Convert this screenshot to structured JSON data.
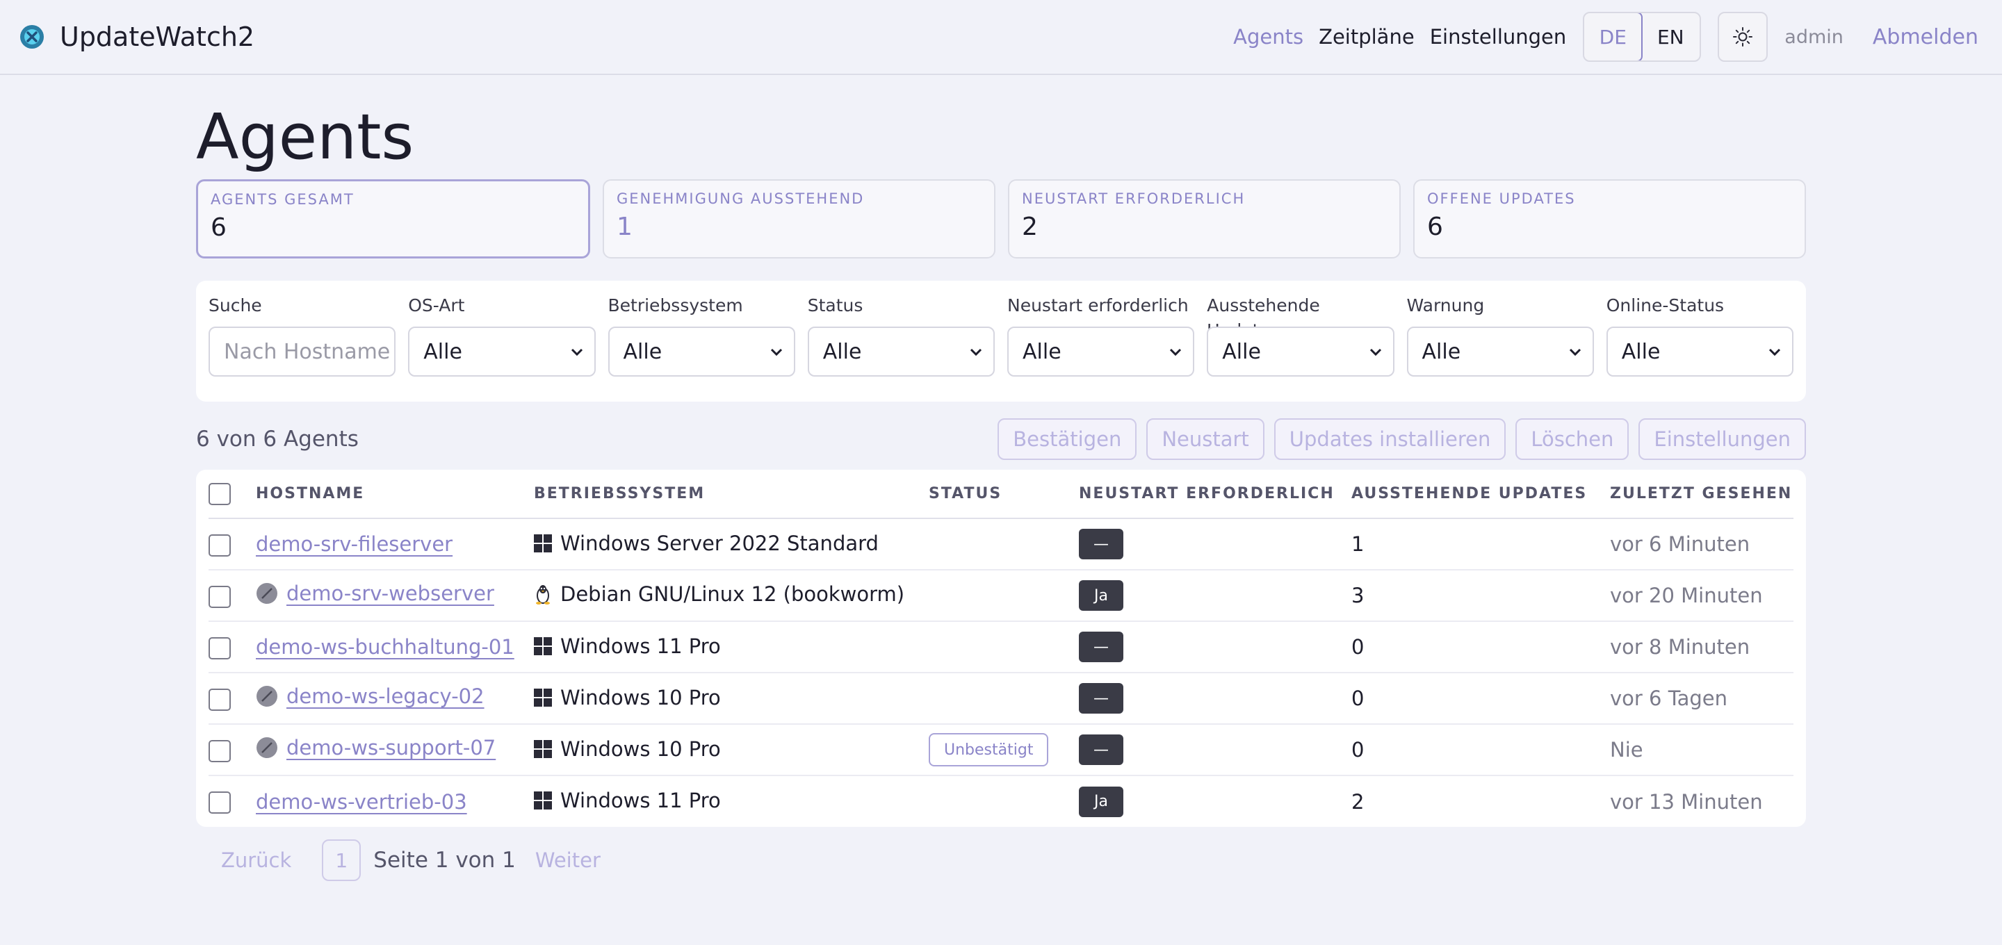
{
  "app": {
    "name": "UpdateWatch2"
  },
  "nav": {
    "links": [
      "Agents",
      "Zeitpläne",
      "Einstellungen"
    ],
    "lang": [
      "DE",
      "EN"
    ],
    "user": "admin",
    "logout": "Abmelden"
  },
  "page": {
    "title": "Agents"
  },
  "stats": [
    {
      "label": "Agents gesamt",
      "value": "6"
    },
    {
      "label": "Genehmigung ausstehend",
      "value": "1"
    },
    {
      "label": "Neustart erforderlich",
      "value": "2"
    },
    {
      "label": "Offene Updates",
      "value": "6"
    }
  ],
  "filters": {
    "search_label": "Suche",
    "search_placeholder": "Nach Hostname f",
    "selects": [
      {
        "label": "OS-Art",
        "value": "Alle"
      },
      {
        "label": "Betriebssystem",
        "value": "Alle"
      },
      {
        "label": "Status",
        "value": "Alle"
      },
      {
        "label": "Neustart erforderlich",
        "value": "Alle"
      },
      {
        "label": "Ausstehende Updates",
        "value": "Alle"
      },
      {
        "label": "Warnung",
        "value": "Alle"
      },
      {
        "label": "Online-Status",
        "value": "Alle"
      }
    ]
  },
  "toolbar": {
    "count": "6 von 6 Agents",
    "actions": [
      "Bestätigen",
      "Neustart",
      "Updates installieren",
      "Löschen",
      "Einstellungen"
    ]
  },
  "table": {
    "headers": [
      "Hostname",
      "Betriebssystem",
      "Status",
      "Neustart erforderlich",
      "Ausstehende Updates",
      "Zuletzt gesehen"
    ],
    "rows": [
      {
        "hostname": "demo-srv-fileserver",
        "offline": false,
        "os_icon": "windows-icon",
        "os": "Windows Server 2022 Standard",
        "status": "",
        "reboot": "—",
        "updates": "1",
        "last_seen": "vor 6 Minuten"
      },
      {
        "hostname": "demo-srv-webserver",
        "offline": true,
        "os_icon": "linux-icon",
        "os": "Debian GNU/Linux 12 (bookworm)",
        "status": "",
        "reboot": "Ja",
        "updates": "3",
        "last_seen": "vor 20 Minuten"
      },
      {
        "hostname": "demo-ws-buchhaltung-01",
        "offline": false,
        "os_icon": "windows-icon",
        "os": "Windows 11 Pro",
        "status": "",
        "reboot": "—",
        "updates": "0",
        "last_seen": "vor 8 Minuten"
      },
      {
        "hostname": "demo-ws-legacy-02",
        "offline": true,
        "os_icon": "windows-icon",
        "os": "Windows 10 Pro",
        "status": "",
        "reboot": "—",
        "updates": "0",
        "last_seen": "vor 6 Tagen"
      },
      {
        "hostname": "demo-ws-support-07",
        "offline": true,
        "os_icon": "windows-icon",
        "os": "Windows 10 Pro",
        "status": "Unbestätigt",
        "reboot": "—",
        "updates": "0",
        "last_seen": "Nie"
      },
      {
        "hostname": "demo-ws-vertrieb-03",
        "offline": false,
        "os_icon": "windows-icon",
        "os": "Windows 11 Pro",
        "status": "",
        "reboot": "Ja",
        "updates": "2",
        "last_seen": "vor 13 Minuten"
      }
    ]
  },
  "pager": {
    "prev": "Zurück",
    "page": "1",
    "text": "Seite 1 von 1",
    "next": "Weiter"
  }
}
